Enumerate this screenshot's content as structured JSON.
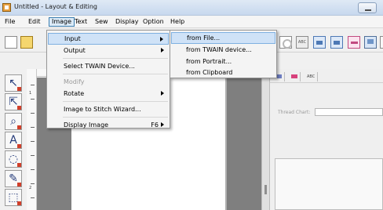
{
  "window": {
    "title": "Untitled - Layout & Editing"
  },
  "menubar": {
    "items": [
      "File",
      "Edit",
      "Image",
      "Text",
      "Sew",
      "Display",
      "Option",
      "Help"
    ],
    "active": "Image"
  },
  "toolbar": {
    "abc_label": "ABC"
  },
  "toolbox": {
    "ruler_marks": [
      "1",
      "2"
    ]
  },
  "image_menu": {
    "items": [
      {
        "label": "Input",
        "has_submenu": true,
        "highlighted": true
      },
      {
        "label": "Output",
        "has_submenu": true
      },
      {
        "label": "Select TWAIN Device..."
      },
      {
        "label": "Modify",
        "disabled": true
      },
      {
        "label": "Rotate",
        "has_submenu": true
      },
      {
        "label": "Image to Stitch Wizard..."
      },
      {
        "label": "Display Image",
        "shortcut": "F6"
      }
    ]
  },
  "input_submenu": {
    "items": [
      "from File...",
      "from TWAIN device...",
      "from Portrait...",
      "from Clipboard"
    ]
  },
  "right_panel": {
    "tabs": [
      "ABC"
    ],
    "thread_chart_label": "Thread Chart:",
    "thread_chart_value": ""
  }
}
